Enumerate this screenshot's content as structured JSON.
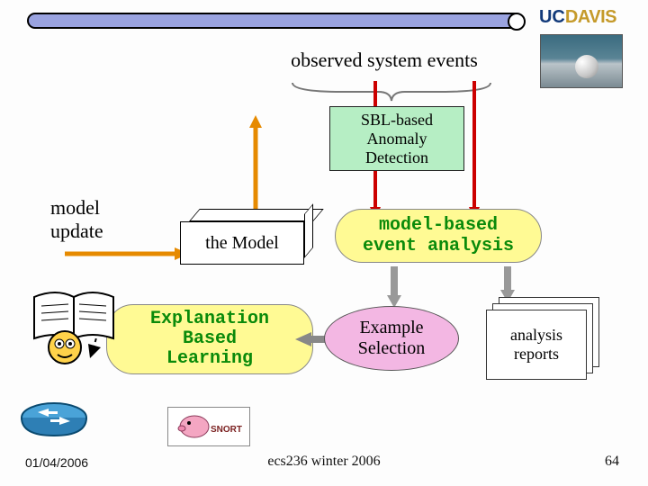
{
  "header": {
    "logo_uc": "UC",
    "logo_davis": "DAVIS"
  },
  "diagram": {
    "observed_label": "observed system events",
    "sbl_line1": "SBL-based",
    "sbl_line2": "Anomaly",
    "sbl_line3": "Detection",
    "model_update_l1": "model",
    "model_update_l2": "update",
    "the_model": "the Model",
    "event_analysis_l1": "model-based",
    "event_analysis_l2": "event analysis",
    "ebl_l1": "Explanation",
    "ebl_l2": "Based",
    "ebl_l3": "Learning",
    "example_sel_l1": "Example",
    "example_sel_l2": "Selection",
    "reports_l1": "analysis",
    "reports_l2": "reports"
  },
  "footer": {
    "date": "01/04/2006",
    "center": "ecs236 winter 2006",
    "page": "64"
  },
  "colors": {
    "topbar": "#9aa3e0",
    "sbl_bg": "#b6eec4",
    "capsule_bg": "#fffa94",
    "pink": "#f3b7e3",
    "green_text": "#0a8a0a"
  }
}
